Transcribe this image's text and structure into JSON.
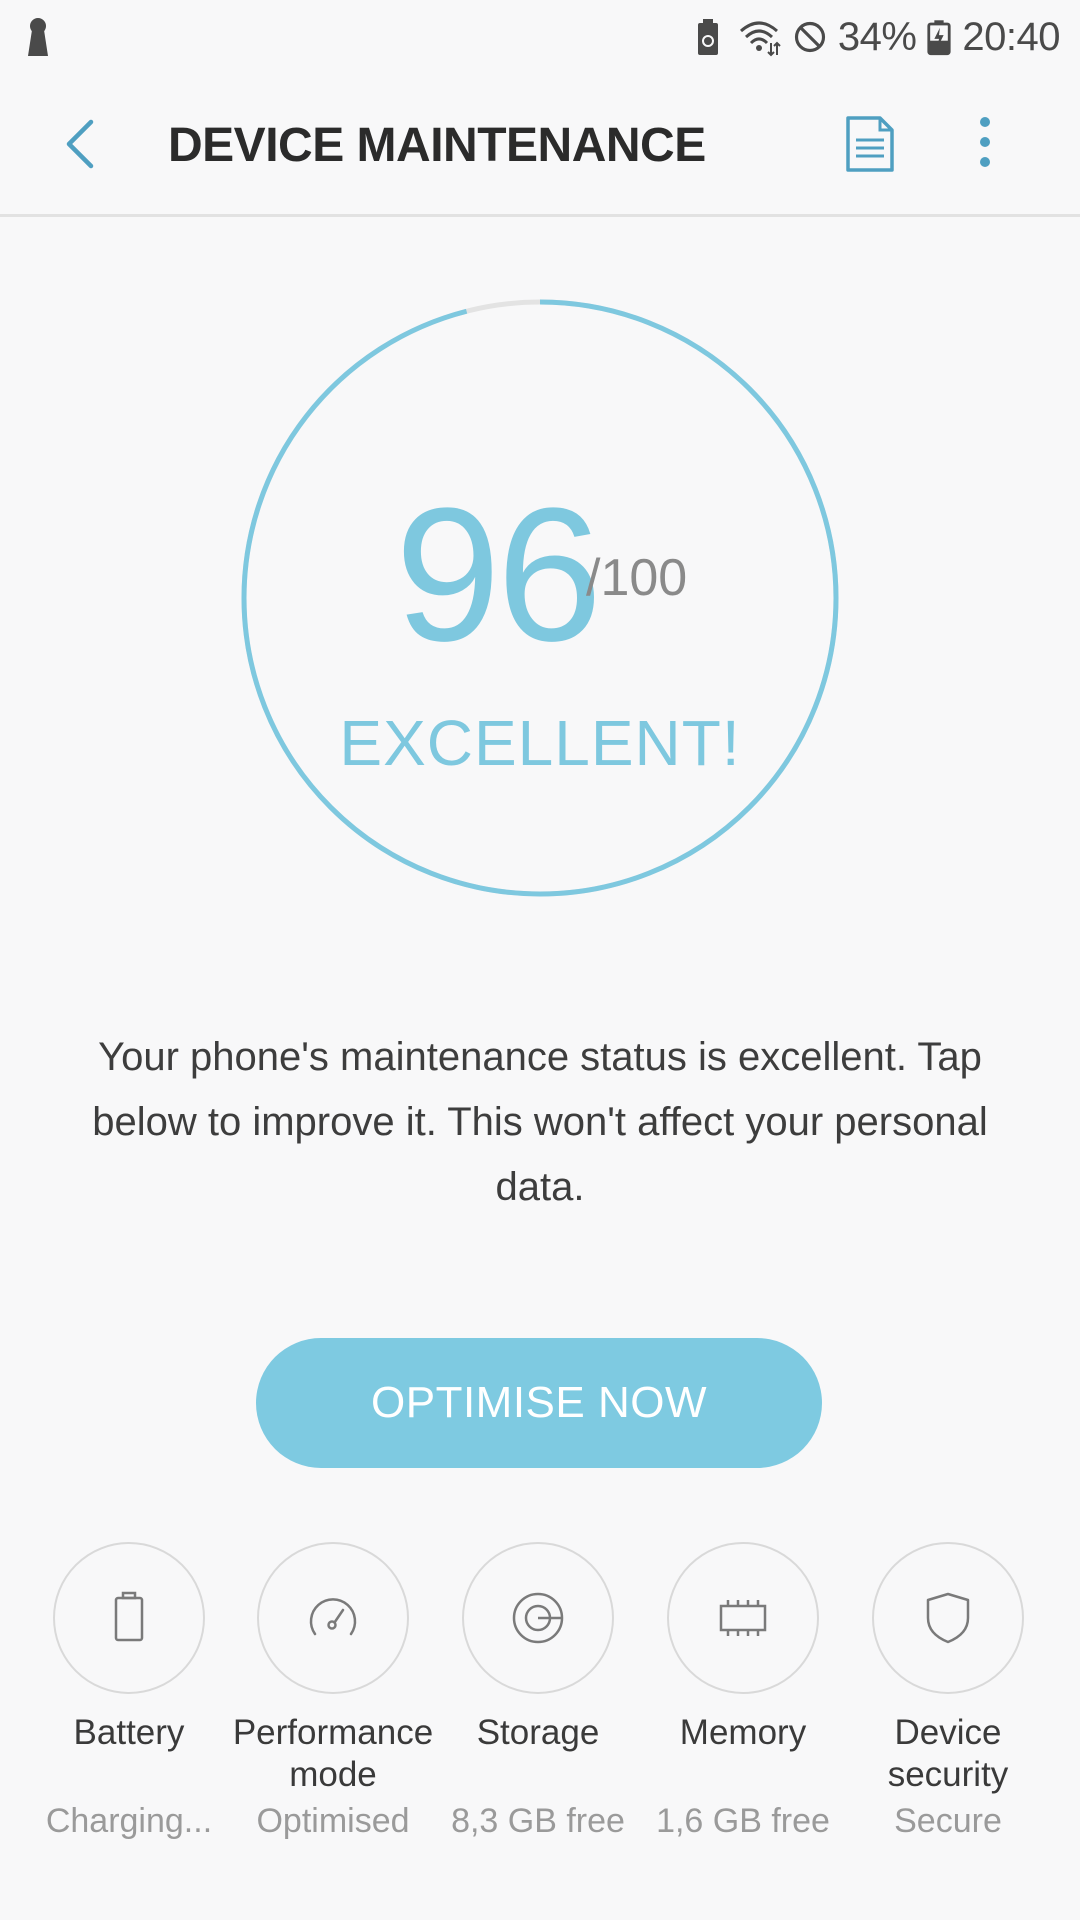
{
  "status_bar": {
    "battery_percent": "34%",
    "time": "20:40"
  },
  "app_bar": {
    "title": "DEVICE MAINTENANCE"
  },
  "score": {
    "value": "96",
    "total": "/100",
    "status": "EXCELLENT!",
    "progress_fraction": 0.96
  },
  "message": "Your phone's maintenance status is excellent. Tap below to improve it. This won't affect your personal data.",
  "optimise_button": {
    "label": "OPTIMISE NOW"
  },
  "features": [
    {
      "label": "Battery",
      "value": "Charging...",
      "icon": "battery-icon"
    },
    {
      "label": "Performance mode",
      "value": "Optimised",
      "icon": "speedometer-icon"
    },
    {
      "label": "Storage",
      "value": "8,3 GB free",
      "icon": "storage-icon"
    },
    {
      "label": "Memory",
      "value": "1,6 GB free",
      "icon": "memory-chip-icon"
    },
    {
      "label": "Device security",
      "value": "Secure",
      "icon": "shield-icon"
    }
  ],
  "colors": {
    "accent": "#7ec8df",
    "background": "#f8f8f9",
    "icon_blue": "#4f9fc1",
    "ring_track": "#e3e3e3"
  }
}
